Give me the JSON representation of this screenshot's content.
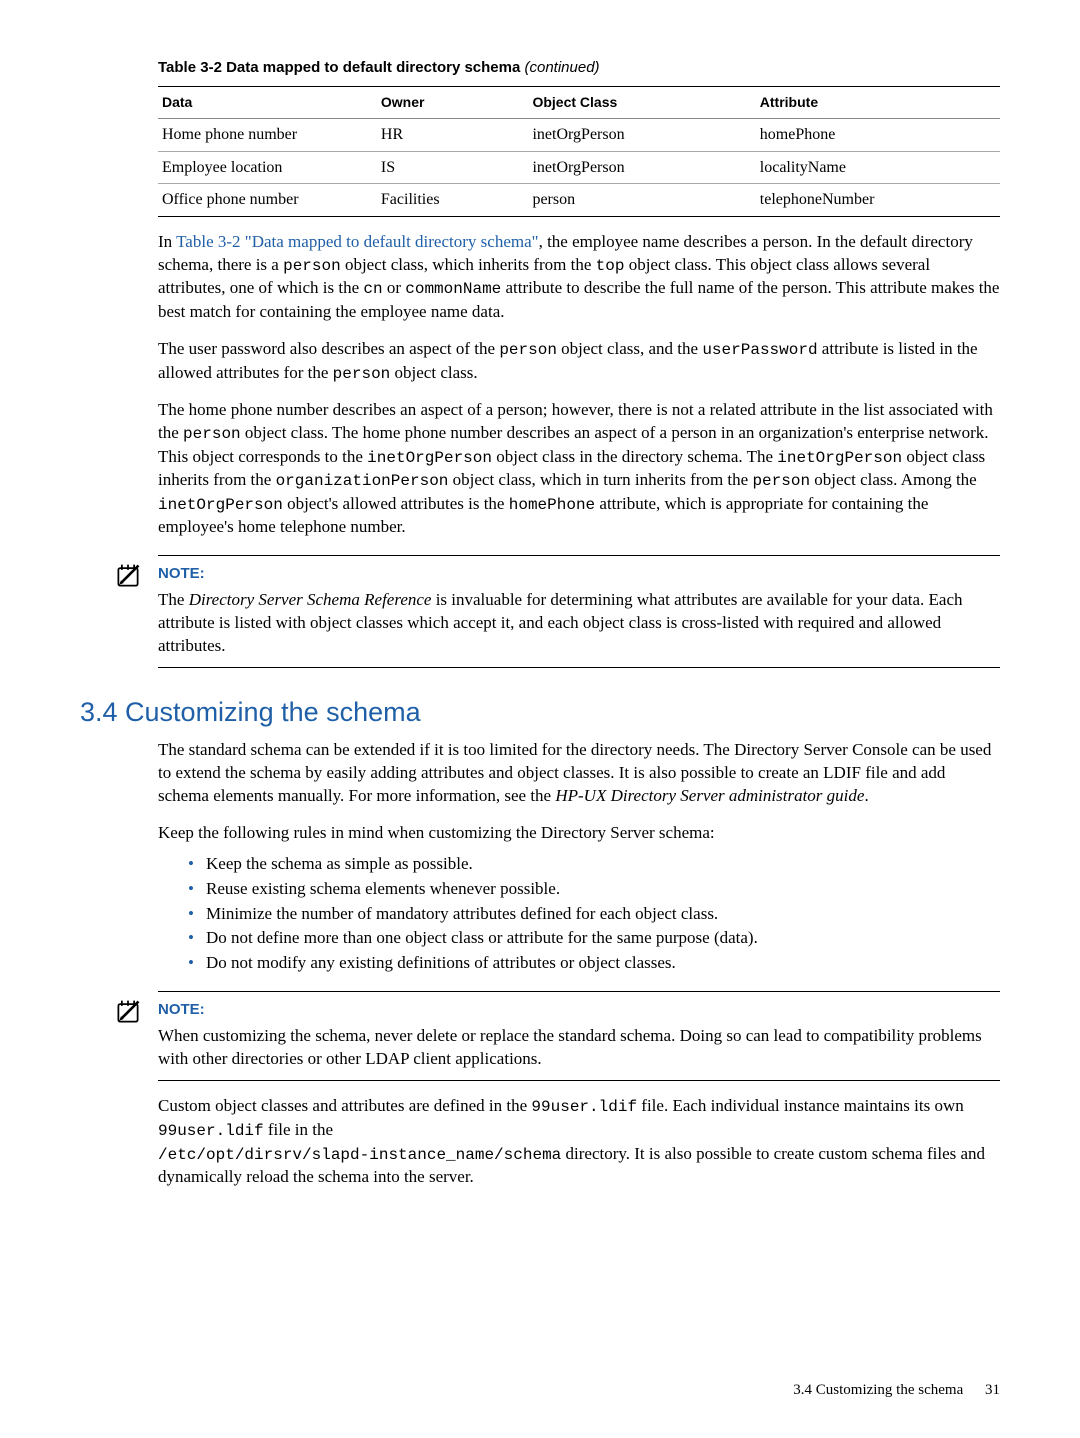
{
  "table": {
    "caption_bold": "Table 3-2 Data mapped to default directory schema",
    "caption_italic": " (continued)",
    "headers": [
      "Data",
      "Owner",
      "Object Class",
      "Attribute"
    ],
    "rows": [
      [
        "Home phone number",
        "HR",
        "inetOrgPerson",
        "homePhone"
      ],
      [
        "Employee location",
        "IS",
        "inetOrgPerson",
        "localityName"
      ],
      [
        "Office phone number",
        "Facilities",
        "person",
        "telephoneNumber"
      ]
    ]
  },
  "para1": {
    "lead": "In ",
    "link": "Table 3-2 \"Data mapped to default directory schema\"",
    "after_link": ", the employee name describes a person. In the default directory schema, there is a ",
    "mono1": "person",
    "mid1": " object class, which inherits from the ",
    "mono2": "top",
    "mid2": " object class. This object class allows several attributes, one of which is the ",
    "mono3": "cn",
    "mid3": " or ",
    "mono4": "commonName",
    "tail": " attribute to describe the full name of the person. This attribute makes the best match for containing the employee name data."
  },
  "para2": {
    "lead": "The user password also describes an aspect of the ",
    "mono1": "person",
    "mid1": " object class, and the ",
    "mono2": "userPassword",
    "mid2": " attribute is listed in the allowed attributes for the ",
    "mono3": "person",
    "tail": " object class."
  },
  "para3": {
    "lead": "The home phone number describes an aspect of a person; however, there is not a related attribute in the list associated with the ",
    "mono1": "person",
    "mid1": " object class. The home phone number describes an aspect of a person in an organization's enterprise network. This object corresponds to the ",
    "mono2": "inetOrgPerson",
    "mid2": " object class in the directory schema. The ",
    "mono3": "inetOrgPerson",
    "mid3": " object class inherits from the ",
    "mono4": "organizationPerson",
    "mid4": " object class, which in turn inherits from the ",
    "mono5": "person",
    "mid5": " object class. Among the ",
    "mono6": "inetOrgPerson",
    "mid6": " object's allowed attributes is the ",
    "mono7": "homePhone",
    "tail": " attribute, which is appropriate for containing the employee's home telephone number."
  },
  "note1": {
    "label": "NOTE:",
    "lead": "The ",
    "italic": "Directory Server Schema Reference",
    "tail": " is invaluable for determining what attributes are available for your data. Each attribute is listed with object classes which accept it, and each object class is cross-listed with required and allowed attributes."
  },
  "heading": "3.4 Customizing the schema",
  "para4": {
    "lead": "The standard schema can be extended if it is too limited for the directory needs. The Directory Server Console can be used to extend the schema by easily adding attributes and object classes. It is also possible to create an LDIF file and add schema elements manually. For more information, see the ",
    "italic": "HP-UX Directory Server administrator guide",
    "tail": "."
  },
  "para5": "Keep the following rules in mind when customizing the Directory Server schema:",
  "bullets": [
    "Keep the schema as simple as possible.",
    "Reuse existing schema elements whenever possible.",
    "Minimize the number of mandatory attributes defined for each object class.",
    "Do not define more than one object class or attribute for the same purpose (data).",
    "Do not modify any existing definitions of attributes or object classes."
  ],
  "note2": {
    "label": "NOTE:",
    "body": "When customizing the schema, never delete or replace the standard schema. Doing so can lead to compatibility problems with other directories or other LDAP client applications."
  },
  "para6": {
    "lead": "Custom object classes and attributes are defined in the ",
    "mono1": "99user.ldif",
    "mid1": " file. Each individual instance maintains its own ",
    "mono2": "99user.ldif",
    "mid2": " file in the ",
    "mono3": "/etc/opt/dirsrv/slapd-instance_name/schema",
    "tail": " directory. It is also possible to create custom schema files and dynamically reload the schema into the server."
  },
  "footer": {
    "text": "3.4 Customizing the schema",
    "page": "31"
  }
}
